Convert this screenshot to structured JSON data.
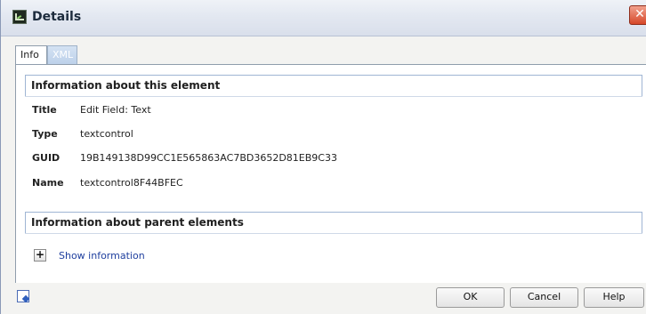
{
  "window": {
    "title": "Details",
    "close_symbol": "✕"
  },
  "tabs": [
    {
      "label": "Info",
      "active": true
    },
    {
      "label": "XML",
      "active": false
    }
  ],
  "element_info": {
    "header": "Information about this element",
    "properties": [
      {
        "label": "Title",
        "value": "Edit Field: Text"
      },
      {
        "label": "Type",
        "value": "textcontrol"
      },
      {
        "label": "GUID",
        "value": "19B149138D99CC1E565863AC7BD3652D81EB9C33"
      },
      {
        "label": "Name",
        "value": "textcontrol8F44BFEC"
      }
    ]
  },
  "parent_info": {
    "header": "Information about parent elements",
    "expand_symbol": "+",
    "link_label": "Show information"
  },
  "footer": {
    "ok_label": "OK",
    "cancel_label": "Cancel",
    "help_label": "Help",
    "icon": "window-restore-icon"
  },
  "colors": {
    "link": "#1f3f9e",
    "section_border": "#9fb5d4",
    "close_button": "#d6482a"
  }
}
